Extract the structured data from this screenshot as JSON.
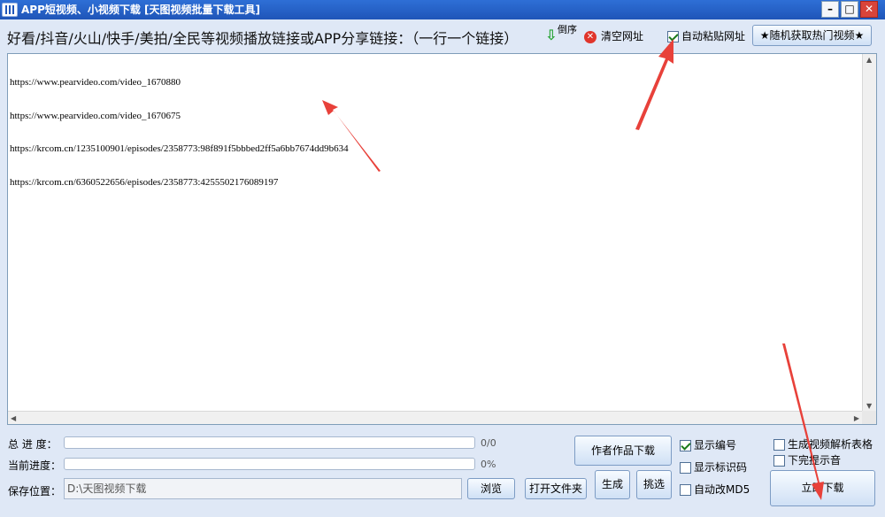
{
  "window": {
    "title": "APP短视频、小视频下载 [天图视频批量下载工具]",
    "minimize": "–",
    "maximize": "□",
    "close": "✕"
  },
  "toolbar": {
    "hint": "好看/抖音/火山/快手/美拍/全民等视频播放链接或APP分享链接：（一行一个链接）",
    "reverse_label": "倒序",
    "clear_label": "清空网址",
    "auto_paste": {
      "label": "自动粘贴网址",
      "checked": true
    },
    "random_hot_label": "★随机获取热门视频★"
  },
  "url_input": {
    "lines": [
      "https://www.pearvideo.com/video_1670880",
      "https://www.pearvideo.com/video_1670675",
      "https://krcom.cn/1235100901/episodes/2358773:98f891f5bbbed2ff5a6bb7674dd9b634",
      "https://krcom.cn/6360522656/episodes/2358773:4255502176089197"
    ]
  },
  "progress": {
    "total_label": "总 进 度：",
    "total_text": "0/0",
    "total_fraction": 0,
    "current_label": "当前进度：",
    "current_text": "0%",
    "current_fraction": 0
  },
  "save": {
    "label": "保存位置：",
    "path": "D:\\天图视频下载",
    "browse_label": "浏览",
    "open_folder_label": "打开文件夹"
  },
  "actions": {
    "author_works_label": "作者作品下载",
    "generate_label": "生成",
    "pick_label": "挑选",
    "download_now_label": "立即下载"
  },
  "options": {
    "show_number": {
      "label": "显示编号",
      "checked": true
    },
    "show_mark": {
      "label": "显示标识码",
      "checked": false
    },
    "auto_md5": {
      "label": "自动改MD5",
      "checked": false
    },
    "gen_table": {
      "label": "生成视频解析表格",
      "checked": false
    },
    "done_sound": {
      "label": "下完提示音",
      "checked": false
    }
  },
  "accent_color": "#e8413a"
}
